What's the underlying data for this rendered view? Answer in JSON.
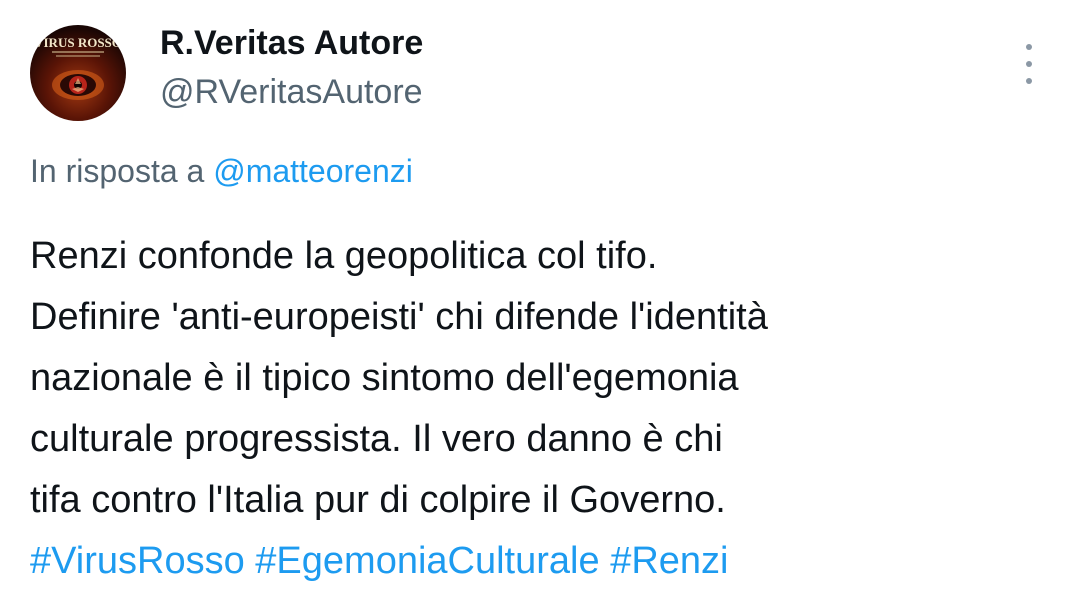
{
  "author": {
    "display_name": "R.Veritas Autore",
    "handle": "@RVeritasAutore",
    "avatar": {
      "icon": "book-cover-avatar",
      "title": "VIRUS ROSSO"
    }
  },
  "menu_icon": "more-vertical-icon",
  "reply": {
    "prefix": "In risposta a",
    "mention": "@matteorenzi"
  },
  "body": {
    "lines": [
      "Renzi confonde la geopolitica col tifo.",
      "Definire 'anti-europeisti' chi difende l'identità",
      "nazionale è il tipico sintomo dell'egemonia",
      "culturale progressista. Il vero danno è chi",
      "tifa contro l'Italia pur di colpire il Governo."
    ],
    "hashtags": [
      "#VirusRosso",
      "#EgemoniaCulturale",
      "#Renzi"
    ]
  },
  "colors": {
    "link": "#1d9bf0",
    "secondary_text": "#536471",
    "primary_text": "#0f1419"
  }
}
